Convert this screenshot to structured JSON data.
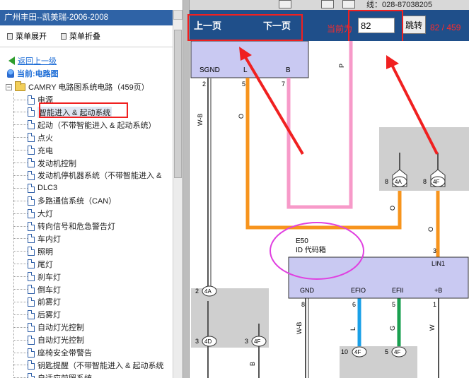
{
  "left_panel": {
    "title": "广州丰田--凯美瑞-2006-2008",
    "menu": {
      "expand_label": "菜单展开",
      "collapse_label": "菜单折叠"
    },
    "back_label": "返回上一级",
    "current_label": "当前:电路图",
    "root_label": "CAMRY 电路图系统电路（459页）",
    "items": [
      {
        "label": "电源"
      },
      {
        "label": "智能进入 & 起动系统",
        "selected": true
      },
      {
        "label": "起动（不带智能进入 & 起动系统）"
      },
      {
        "label": "点火"
      },
      {
        "label": "充电"
      },
      {
        "label": "发动机控制"
      },
      {
        "label": "发动机停机器系统（不带智能进入 &"
      },
      {
        "label": "DLC3"
      },
      {
        "label": "多路通信系统（CAN）"
      },
      {
        "label": "大灯"
      },
      {
        "label": "转向信号和危急警告灯"
      },
      {
        "label": "车内灯"
      },
      {
        "label": "照明"
      },
      {
        "label": "尾灯"
      },
      {
        "label": "刹车灯"
      },
      {
        "label": "倒车灯"
      },
      {
        "label": "前雾灯"
      },
      {
        "label": "后雾灯"
      },
      {
        "label": "自动灯光控制"
      },
      {
        "label": "自动灯光控制"
      },
      {
        "label": "座椅安全带警告"
      },
      {
        "label": "钥匙提醒（不带智能进入 & 起动系统"
      },
      {
        "label": "自适应前照系统"
      }
    ]
  },
  "toolbar": {
    "prev_label": "上一页",
    "next_label": "下一页",
    "current_label": "当前为",
    "page_value": "82",
    "jump_label": "跳转",
    "page_status": "82 / 459",
    "top_strip_text": "线：028-87038205"
  },
  "diagram": {
    "top_module": {
      "pins": [
        "SGND",
        "L",
        "B"
      ],
      "pin_numbers": [
        "2",
        "5",
        "7"
      ]
    },
    "wire_labels": [
      "W-B",
      "O",
      "P",
      "O",
      "O",
      "W-B",
      "L",
      "G",
      "W",
      "B"
    ],
    "connectors_top": [
      "4A",
      "4F"
    ],
    "connector_pin_numbers_top": [
      "8",
      "8"
    ],
    "e50": {
      "code": "E50",
      "name": "ID 代码箱",
      "pin_top": "LIN1",
      "pin_top_number": "3",
      "pins_bottom": [
        "GND",
        "EFIO",
        "EFII",
        "+B"
      ],
      "pin_bottom_numbers": [
        "8",
        "6",
        "5",
        "1"
      ]
    },
    "left_connectors": [
      {
        "num": "2",
        "id": "4A"
      },
      {
        "num": "3",
        "id": "4D"
      },
      {
        "num": "3",
        "id": "4F"
      }
    ],
    "bottom_connectors": [
      {
        "num": "10",
        "id": "4F"
      },
      {
        "num": "5",
        "id": "4F"
      }
    ],
    "colors": {
      "pink_wire": "#f79ac9",
      "orange_wire": "#f7941d",
      "blue_wire": "#1aa0e8",
      "green_wire": "#1aa050",
      "module_fill": "#c9c9f2",
      "highlight_ellipse": "#e040e0",
      "annotation_red": "#f02020"
    }
  }
}
